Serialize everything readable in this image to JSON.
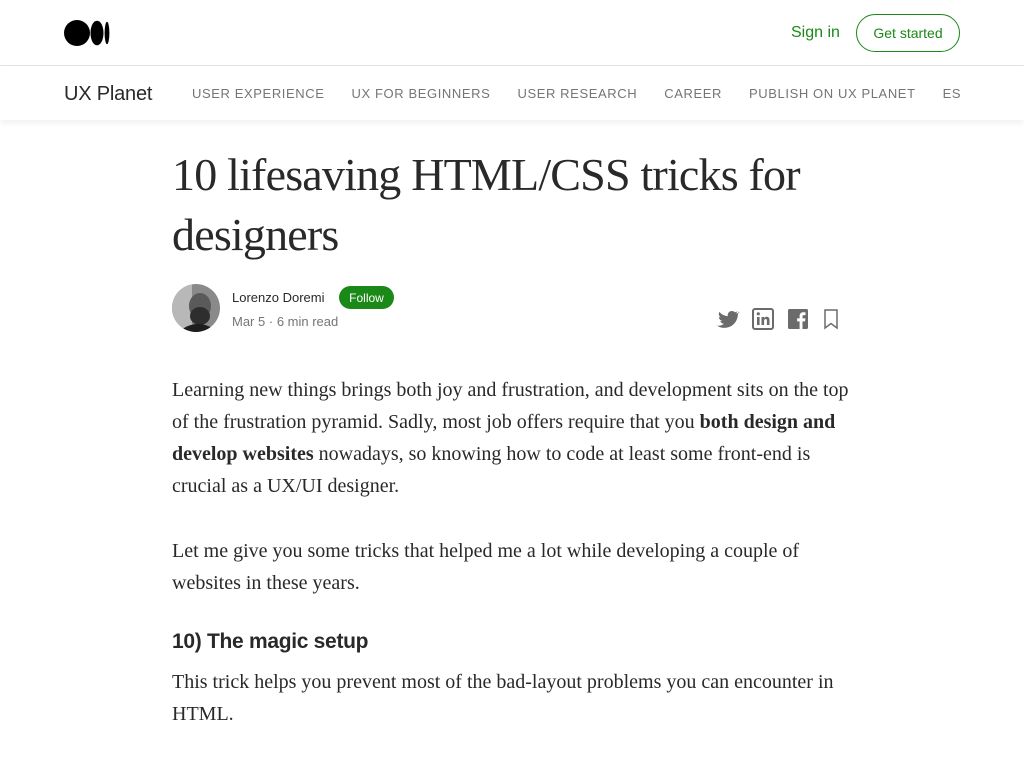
{
  "header": {
    "logo_icon": "medium-logo-icon",
    "signin_label": "Sign in",
    "get_started_label": "Get started",
    "accent_color": "#1a8917"
  },
  "publication": {
    "name": "UX Planet",
    "nav": [
      "USER EXPERIENCE",
      "UX FOR BEGINNERS",
      "USER RESEARCH",
      "CAREER",
      "PUBLISH ON UX PLANET",
      "ES"
    ]
  },
  "article": {
    "title": "10 lifesaving HTML/CSS tricks for designers",
    "author": "Lorenzo Doremi",
    "follow_label": "Follow",
    "date": "Mar 5",
    "separator": "·",
    "read_time": "6 min read",
    "share_icons": [
      "twitter-icon",
      "linkedin-icon",
      "facebook-icon",
      "bookmark-icon"
    ],
    "p1_before": "Learning new things brings both joy and frustration, and development sits on the top of the frustration pyramid. Sadly, most job offers require that you ",
    "p1_bold": "both design and develop websites",
    "p1_after": " nowadays, so knowing how to code at least some front-end is crucial as a UX/UI designer.",
    "p2": "Let me give you some tricks that helped me a lot while developing a couple of websites in these years.",
    "subhead": "10) The magic setup",
    "p3": "This trick helps you prevent most of the bad-layout problems you can encounter in HTML."
  }
}
